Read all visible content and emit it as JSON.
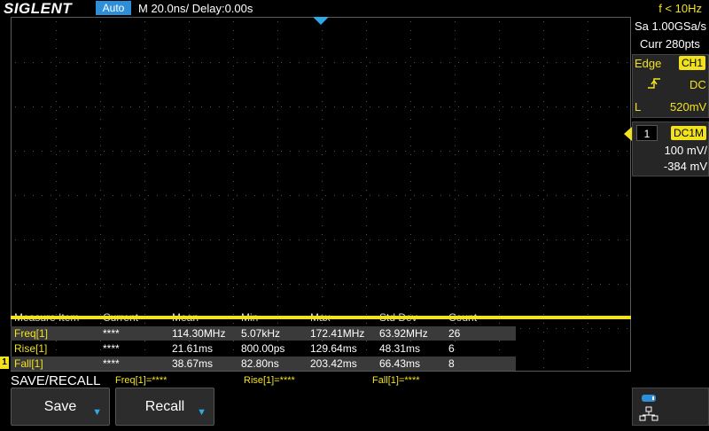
{
  "header": {
    "brand": "SIGLENT",
    "run_status": "Auto",
    "timebase": "M 20.0ns/",
    "delay": "Delay:0.00s",
    "frequency": "f < 10Hz"
  },
  "acquisition": {
    "sample_rate": "Sa 1.00GSa/s",
    "curr_points": "Curr 280pts"
  },
  "trigger": {
    "type": "Edge",
    "source": "CH1",
    "coupling": "DC",
    "level_label": "L",
    "level": "520mV",
    "slope_icon": "rising-edge-icon"
  },
  "channel": {
    "number": "1",
    "coupling": "DC1M",
    "scale": "100 mV/",
    "offset": "-384 mV",
    "marker": "1"
  },
  "measure": {
    "headers": [
      "Measure Item",
      "Current",
      "Mean",
      "Min",
      "Max",
      "Std Dev",
      "Count"
    ],
    "rows": [
      {
        "item": "Freq[1]",
        "current": "****",
        "mean": "114.30MHz",
        "min": "5.07kHz",
        "max": "172.41MHz",
        "std_dev": "63.92MHz",
        "count": "26"
      },
      {
        "item": "Rise[1]",
        "current": "****",
        "mean": "21.61ms",
        "min": "800.00ps",
        "max": "129.64ms",
        "std_dev": "48.31ms",
        "count": "6"
      },
      {
        "item": "Fall[1]",
        "current": "****",
        "mean": "38.67ms",
        "min": "82.80ns",
        "max": "203.42ms",
        "std_dev": "66.43ms",
        "count": "8"
      }
    ]
  },
  "bottom": {
    "menu_title": "SAVE/RECALL",
    "measurements": [
      "Freq[1]=****",
      "Rise[1]=****",
      "Fall[1]=****"
    ],
    "softkeys": [
      {
        "label": "Save"
      },
      {
        "label": "Recall"
      }
    ]
  },
  "colors": {
    "channel1": "#f2e21e",
    "accent_blue": "#2e8fd8",
    "background": "#000000"
  }
}
